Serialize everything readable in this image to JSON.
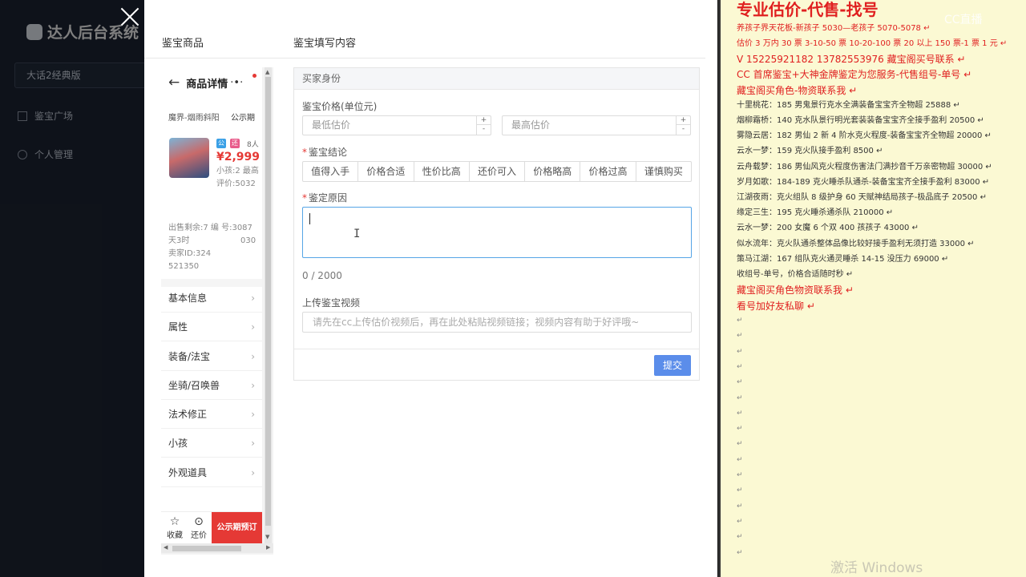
{
  "sidebar": {
    "brand": "达人后台系统",
    "version_select": "大话2经典版",
    "items": [
      {
        "label": "鉴宝广场"
      },
      {
        "label": "个人管理"
      }
    ]
  },
  "dialog": {
    "left_header": "鉴宝商品",
    "right_header": "鉴宝填写内容"
  },
  "phone": {
    "title": "商品详情",
    "server": "魔界-烟雨斜阳",
    "status": "公示期",
    "tag_public": "公",
    "tag_return": "还",
    "people": "8人",
    "price": "¥2,999",
    "child_info": "小孩:2 最高评价:5032",
    "sale_meta": "出售剩余:7 编 号:3087",
    "sale_meta2": "天3时",
    "sale_meta3": "030",
    "seller": "卖家ID:324",
    "seller2": "521350",
    "menu": [
      "基本信息",
      "属性",
      "装备/法宝",
      "坐骑/召唤兽",
      "法术修正",
      "小孩",
      "外观道具"
    ],
    "bottom": {
      "collect": "收藏",
      "bargain": "还价",
      "cta": "公示期预订"
    }
  },
  "form": {
    "section_title": "买家身份",
    "price_label": "鉴宝价格(单位元)",
    "min_placeholder": "最低估价",
    "max_placeholder": "最高估价",
    "conclusion_label": "鉴宝结论",
    "options": [
      "值得入手",
      "价格合适",
      "性价比高",
      "还价可入",
      "价格略高",
      "价格过高",
      "谨慎购买"
    ],
    "reason_label": "鉴定原因",
    "counter": "0 / 2000",
    "video_label": "上传鉴宝视频",
    "video_placeholder": "请先在cc上传估价视频后，再在此处粘贴视频链接；视频内容有助于好评哦~",
    "submit": "提交"
  },
  "note": {
    "title": "专业估价-代售-找号",
    "lines": [
      {
        "text": "养孩子界天花板-新孩子 5030—老孩子 5070-5078",
        "style": "red"
      },
      {
        "text": "估价 3 万内 30 票 3-10-50 票 10-20-100 票 20 以上 150 票-1 票 1 元",
        "style": "red"
      },
      {
        "text": "V 15225921182      13782553976    藏宝阁买号联系",
        "style": "red big"
      },
      {
        "text": "CC 首席鉴宝+大神金牌鉴定为您服务-代售组号-单号",
        "style": "red big"
      },
      {
        "text": "藏宝阁买角色-物资联系我",
        "style": "red big"
      },
      {
        "text": "十里桃花：185 男鬼景行克水全满装备宝宝齐全物超 25888",
        "style": "dark"
      },
      {
        "text": "烟柳霜桥：140 克水队景行明光套装装备宝宝齐全接手盈利 20500",
        "style": "dark"
      },
      {
        "text": "雾隐云居：182 男仙 2 新 4 阶水克火程度-装备宝宝齐全物超 20000",
        "style": "dark"
      },
      {
        "text": "云水一梦：159 克火队接手盈利 8500",
        "style": "dark"
      },
      {
        "text": "云舟载梦：186 男仙风克火程度伤害法门满抄音千万亲密物超 30000",
        "style": "dark"
      },
      {
        "text": "岁月如歌：184-189 克火睡杀队通杀-装备宝宝齐全接手盈利 83000",
        "style": "dark"
      },
      {
        "text": "江湖夜雨：克火组队 8 级护身 60 天赋神结局孩子-极品底子 20500",
        "style": "dark"
      },
      {
        "text": "缘定三生：195 克火睡杀通杀队 210000",
        "style": "dark"
      },
      {
        "text": "云水一梦：200 女魔 6 个双 400 孩孩子 43000",
        "style": "dark"
      },
      {
        "text": "似水流年：克火队通杀整体品像比较好接手盈利无须打造 33000",
        "style": "dark"
      },
      {
        "text": "策马江湖：167 组队克火通灵睡杀 14-15 没压力 69000",
        "style": "dark"
      },
      {
        "text": "收组号-单号，价格合适随时秒",
        "style": "dark"
      },
      {
        "text": "藏宝阁买角色物资联系我",
        "style": "red big"
      },
      {
        "text": "看号加好友私聊",
        "style": "red big"
      }
    ],
    "pilcrow": "↵",
    "cc_logo": "CC直播",
    "watermark": "激活 Windows"
  },
  "colors": {
    "accent": "#5b8dea",
    "red": "#e02020",
    "note_bg": "#fbf9d3",
    "sidebar_bg": "#1b2230"
  }
}
